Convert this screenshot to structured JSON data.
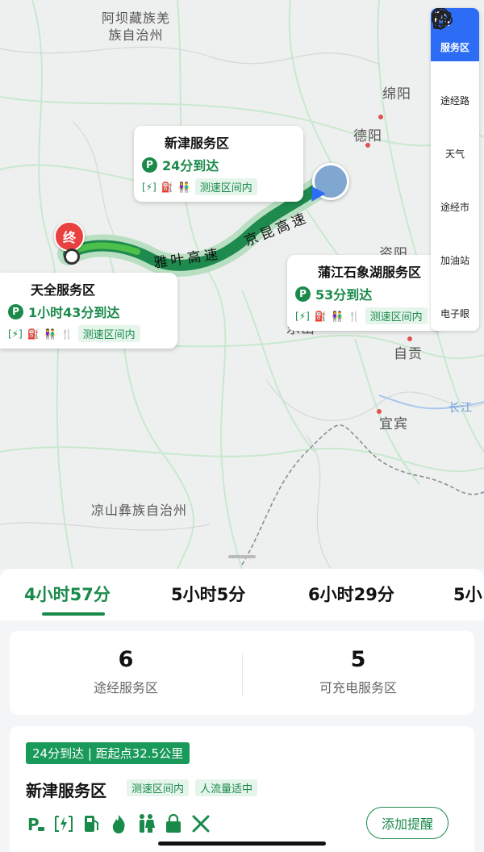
{
  "map": {
    "regions": [
      {
        "id": "aba",
        "label": "阿坝藏族羌\n族自治州"
      },
      {
        "id": "liangshan",
        "label": "凉山彝族自治州"
      }
    ],
    "cities": [
      {
        "id": "mianyang",
        "label": "绵阳"
      },
      {
        "id": "deyang",
        "label": "德阳"
      },
      {
        "id": "ziyang",
        "label": "资阳"
      },
      {
        "id": "leshan",
        "label": "乐山"
      },
      {
        "id": "zigong",
        "label": "自贡"
      },
      {
        "id": "yibin",
        "label": "宜宾"
      },
      {
        "id": "changjiang",
        "label": "长江"
      }
    ],
    "highways": [
      {
        "id": "yaye",
        "label": "雅叶高速"
      },
      {
        "id": "jingkun",
        "label": "京昆高速"
      }
    ],
    "end_pin_label": "终",
    "callouts": [
      {
        "id": "xinjin",
        "title": "新津服务区",
        "eta": "24分到达",
        "tag": "测速区间内"
      },
      {
        "id": "tianquan",
        "title": "天全服务区",
        "eta": "1小时43分到达",
        "tag": "测速区间内"
      },
      {
        "id": "pujiang",
        "title": "蒲江石象湖服务区",
        "eta": "53分到达",
        "tag": "测速区间内"
      }
    ]
  },
  "right_bar": {
    "items": [
      {
        "id": "service",
        "label": "服务区",
        "icon": "parking-cup-icon",
        "active": true
      },
      {
        "id": "route",
        "label": "途经路",
        "icon": "road-icon",
        "active": false
      },
      {
        "id": "weather",
        "label": "天气",
        "icon": "cloud-icon",
        "active": false
      },
      {
        "id": "city",
        "label": "途经市",
        "icon": "location-icon",
        "active": false
      },
      {
        "id": "gas",
        "label": "加油站",
        "icon": "fuel-icon",
        "active": false
      },
      {
        "id": "camera",
        "label": "电子眼",
        "icon": "camera-icon",
        "active": false
      }
    ]
  },
  "routes": {
    "tabs": [
      {
        "label": "4小时57分",
        "active": true
      },
      {
        "label": "5小时5分",
        "active": false
      },
      {
        "label": "6小时29分",
        "active": false
      },
      {
        "label": "5小",
        "active": false
      }
    ]
  },
  "stats": {
    "service_count": "6",
    "service_label": "途经服务区",
    "charging_count": "5",
    "charging_label": "可充电服务区"
  },
  "card": {
    "eta": "24分到达 | 距起点32.5公里",
    "name": "新津服务区",
    "tags": [
      "测速区间内",
      "人流量适中"
    ],
    "remind_label": "添加提醒"
  },
  "colors": {
    "accent": "#1a8a4a",
    "route": "#1e8a4e",
    "active_blue": "#2d6df6",
    "end_pin": "#e94040"
  }
}
